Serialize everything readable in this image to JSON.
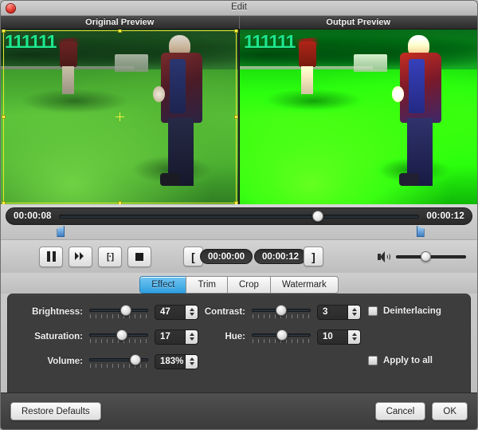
{
  "window": {
    "title": "Edit",
    "close_icon": "close-icon"
  },
  "previews": {
    "original_label": "Original Preview",
    "output_label": "Output Preview",
    "watermark_text": "111111"
  },
  "timeline": {
    "current_time": "00:00:08",
    "total_time": "00:00:12",
    "playhead_percent": 72,
    "trim_start_percent": 11,
    "trim_end_percent": 88
  },
  "transport": {
    "pause_icon": "pause-icon",
    "forward_icon": "fast-forward-icon",
    "frame_icon": "[·]",
    "stop_icon": "stop-icon",
    "trim_start_bracket": "[",
    "trim_start_time": "00:00:00",
    "trim_end_time": "00:00:12",
    "trim_end_bracket": "]",
    "volume_icon": "speaker-icon",
    "volume_percent": 42
  },
  "tabs": [
    {
      "label": "Effect",
      "active": true
    },
    {
      "label": "Trim",
      "active": false
    },
    {
      "label": "Crop",
      "active": false
    },
    {
      "label": "Watermark",
      "active": false
    }
  ],
  "effect": {
    "brightness": {
      "label": "Brightness:",
      "value": "47",
      "slider_percent": 62
    },
    "saturation": {
      "label": "Saturation:",
      "value": "17",
      "slider_percent": 55
    },
    "volume": {
      "label": "Volume:",
      "value": "183%",
      "slider_percent": 78
    },
    "contrast": {
      "label": "Contrast:",
      "value": "3",
      "slider_percent": 50
    },
    "hue": {
      "label": "Hue:",
      "value": "10",
      "slider_percent": 52
    },
    "deinterlacing": {
      "label": "Deinterlacing",
      "checked": false
    },
    "apply_to_all": {
      "label": "Apply to all",
      "checked": false
    }
  },
  "footer": {
    "restore_defaults": "Restore Defaults",
    "cancel": "Cancel",
    "ok": "OK"
  },
  "colors": {
    "accent_tab": "#2f9fe0",
    "panel_bg": "#3d3d3d",
    "watermark": "#1ee68c",
    "crop_outline": "#e8e82e"
  }
}
